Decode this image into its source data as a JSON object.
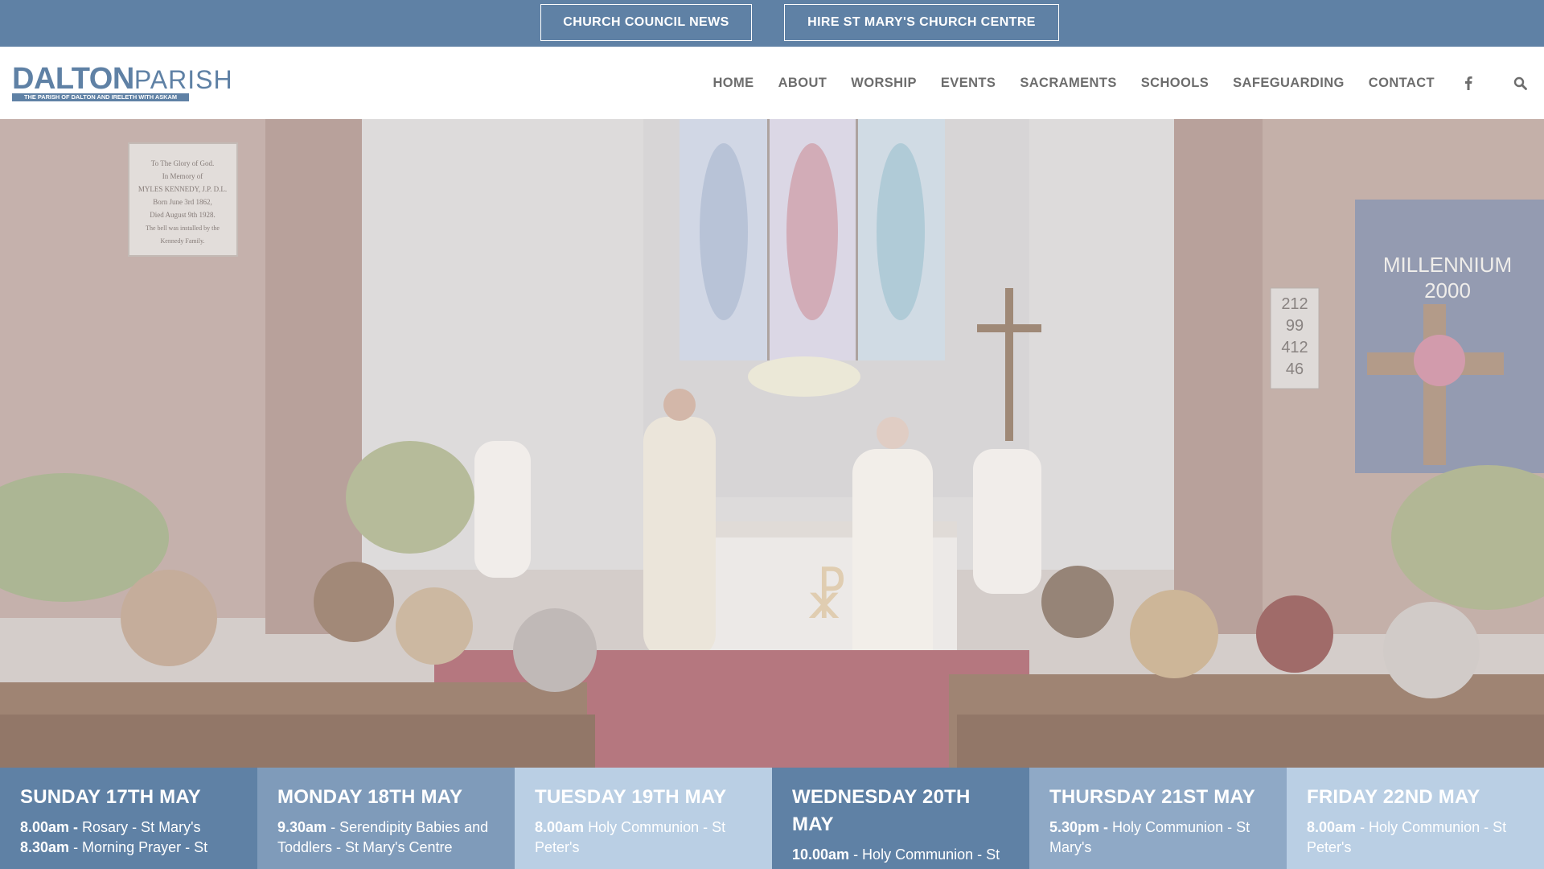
{
  "topbar": {
    "buttons": [
      "CHURCH COUNCIL NEWS",
      "HIRE ST MARY'S CHURCH CENTRE"
    ]
  },
  "logo": {
    "dalton": "DALTON",
    "parish": "PARISH",
    "tagline": "THE PARISH OF DALTON AND IRELETH WITH ASKAM"
  },
  "nav": {
    "items": [
      "HOME",
      "ABOUT",
      "WORSHIP",
      "EVENTS",
      "SACRAMENTS",
      "SCHOOLS",
      "SAFEGUARDING",
      "CONTACT"
    ],
    "icons": [
      "facebook-icon",
      "search-icon"
    ]
  },
  "hero": {
    "memorial_plaque": [
      "To The Glory of God.",
      "In Memory of",
      "MYLES KENNEDY, J.P. D.L.",
      "Born June 3rd 1862,",
      "Died August 9th 1928.",
      "The bell was installed by the",
      "Kennedy Family."
    ],
    "banner_text": [
      "MILLENNIUM",
      "2000"
    ],
    "hymn_board": [
      "212",
      "99",
      "412",
      "46"
    ]
  },
  "schedule": {
    "days": [
      {
        "title": "SUNDAY 17TH MAY",
        "entries": [
          {
            "time": "8.00am -",
            "text": " Rosary - St Mary's"
          },
          {
            "time": "8.30am",
            "text": " - Morning Prayer - St"
          }
        ]
      },
      {
        "title": "MONDAY 18TH MAY",
        "entries": [
          {
            "time": "9.30am",
            "text": " - Serendipity Babies and Toddlers - St Mary's Centre"
          }
        ]
      },
      {
        "title": "TUESDAY 19TH MAY",
        "entries": [
          {
            "time": "8.00am",
            "text": " Holy Communion - St Peter's"
          }
        ]
      },
      {
        "title": "WEDNESDAY 20TH MAY",
        "entries": [
          {
            "time": "10.00am",
            "text": " - Holy Communion - St"
          }
        ]
      },
      {
        "title": "THURSDAY 21ST MAY",
        "entries": [
          {
            "time": "5.30pm -",
            "text": " Holy Communion - St Mary's"
          }
        ]
      },
      {
        "title": "FRIDAY 22ND MAY",
        "entries": [
          {
            "time": "8.00am",
            "text": " - Holy Communion - St Peter's"
          }
        ]
      }
    ]
  },
  "colors": {
    "brand_blue": "#5f81a5",
    "nav_text": "#6d6d6d",
    "light_blue": "#bacfe4"
  }
}
